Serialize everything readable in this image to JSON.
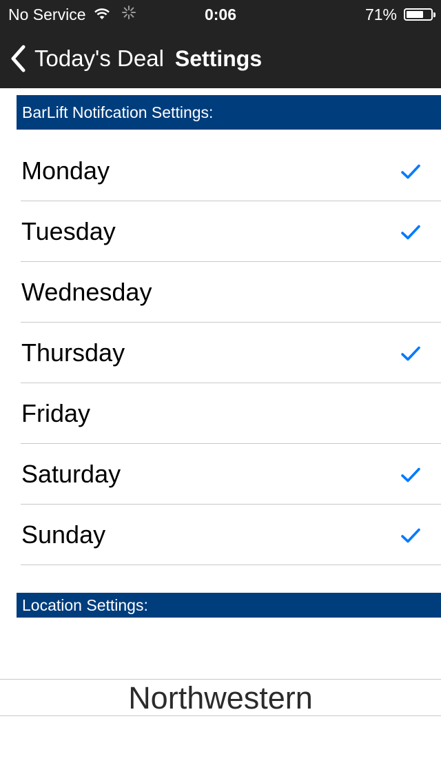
{
  "status_bar": {
    "carrier": "No Service",
    "time": "0:06",
    "battery_percent": "71%",
    "battery_level": 0.71,
    "icons": [
      "wifi-icon",
      "activity-spinner-icon",
      "battery-icon"
    ]
  },
  "nav": {
    "back_label": "Today's Deal",
    "title": "Settings",
    "back_icon": "chevron-left-icon"
  },
  "sections": {
    "notifications_header": "BarLift Notifcation Settings:",
    "location_header": "Location Settings:"
  },
  "days": [
    {
      "label": "Monday",
      "checked": true
    },
    {
      "label": "Tuesday",
      "checked": true
    },
    {
      "label": "Wednesday",
      "checked": false
    },
    {
      "label": "Thursday",
      "checked": true
    },
    {
      "label": "Friday",
      "checked": false
    },
    {
      "label": "Saturday",
      "checked": true
    },
    {
      "label": "Sunday",
      "checked": true
    }
  ],
  "location_picker": {
    "selected": "Northwestern"
  },
  "colors": {
    "nav_background": "#232323",
    "section_header": "#003d7d",
    "checkmark": "#007aff",
    "divider": "#c8c7cc"
  }
}
